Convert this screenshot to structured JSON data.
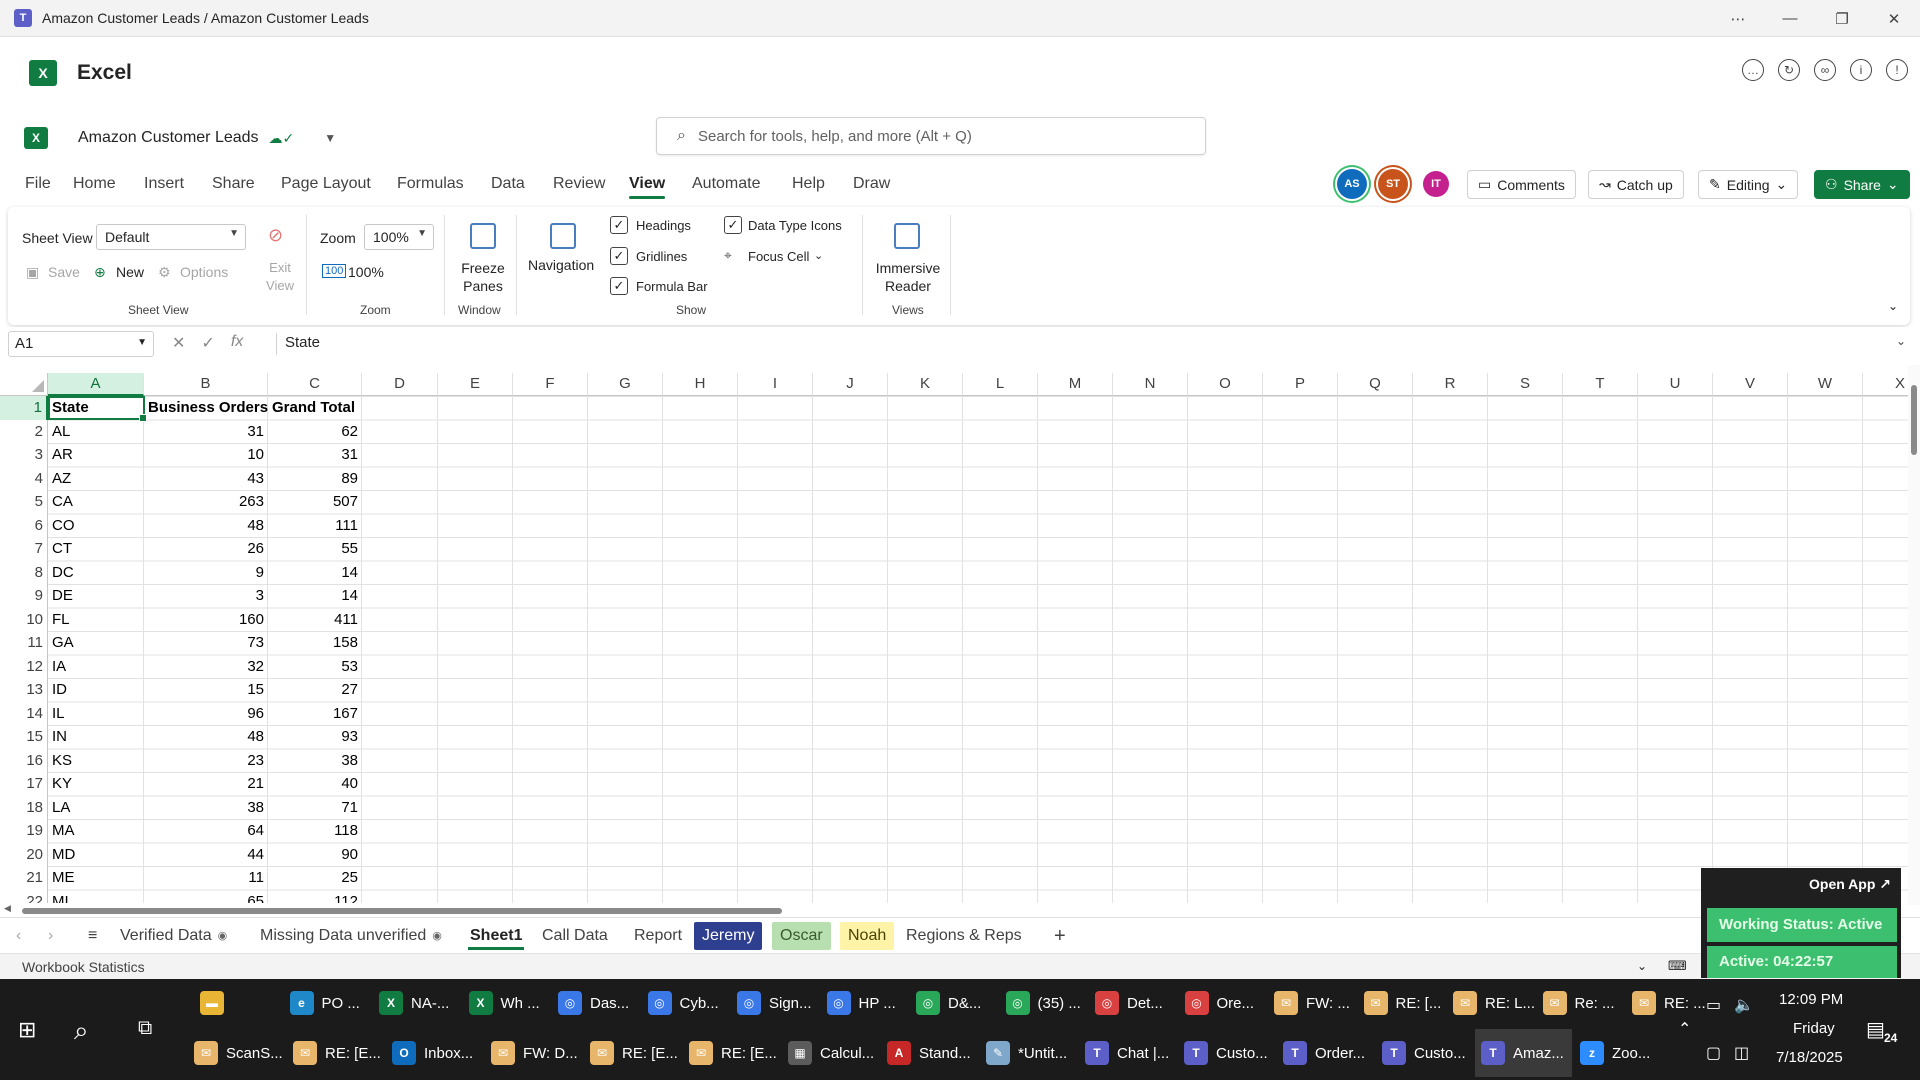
{
  "window": {
    "title": "Amazon Customer Leads / Amazon Customer Leads"
  },
  "app": {
    "name": "Excel"
  },
  "workbook": {
    "name": "Amazon Customer Leads"
  },
  "search": {
    "placeholder": "Search for tools, help, and more (Alt + Q)"
  },
  "menu": [
    "File",
    "Home",
    "Insert",
    "Share",
    "Page Layout",
    "Formulas",
    "Data",
    "Review",
    "View",
    "Automate",
    "Help",
    "Draw"
  ],
  "active_menu": "View",
  "avatars": [
    {
      "initials": "AS",
      "color": "#0f6cbd"
    },
    {
      "initials": "ST",
      "color": "#c8531b"
    },
    {
      "initials": "IT",
      "color": "#c4218f"
    }
  ],
  "top_buttons": {
    "comments": "Comments",
    "catchup": "Catch up",
    "editing": "Editing",
    "share": "Share"
  },
  "ribbon": {
    "sheet_view_label": "Sheet View",
    "sheet_view_value": "Default",
    "save": "Save",
    "new": "New",
    "options": "Options",
    "exit_view": "Exit View",
    "group_sheet_view": "Sheet View",
    "zoom_label": "Zoom",
    "zoom_value": "100%",
    "zoom_100": "100%",
    "group_zoom": "Zoom",
    "freeze_panes": "Freeze Panes",
    "group_window": "Window",
    "navigation": "Navigation",
    "headings": "Headings",
    "gridlines": "Gridlines",
    "formula_bar": "Formula Bar",
    "data_type_icons": "Data Type Icons",
    "focus_cell": "Focus Cell",
    "group_show": "Show",
    "immersive_reader": "Immersive Reader",
    "group_views": "Views"
  },
  "formula_bar": {
    "name_box": "A1",
    "fx": "fx",
    "value": "State"
  },
  "columns": [
    "A",
    "B",
    "C",
    "D",
    "E",
    "F",
    "G",
    "H",
    "I",
    "J",
    "K",
    "L",
    "M",
    "N",
    "O",
    "P",
    "Q",
    "R",
    "S",
    "T",
    "U",
    "V",
    "W",
    "X"
  ],
  "headers": [
    "State",
    "Business Orders",
    "Grand Total"
  ],
  "rows": [
    [
      "AL",
      "31",
      "62"
    ],
    [
      "AR",
      "10",
      "31"
    ],
    [
      "AZ",
      "43",
      "89"
    ],
    [
      "CA",
      "263",
      "507"
    ],
    [
      "CO",
      "48",
      "111"
    ],
    [
      "CT",
      "26",
      "55"
    ],
    [
      "DC",
      "9",
      "14"
    ],
    [
      "DE",
      "3",
      "14"
    ],
    [
      "FL",
      "160",
      "411"
    ],
    [
      "GA",
      "73",
      "158"
    ],
    [
      "IA",
      "32",
      "53"
    ],
    [
      "ID",
      "15",
      "27"
    ],
    [
      "IL",
      "96",
      "167"
    ],
    [
      "IN",
      "48",
      "93"
    ],
    [
      "KS",
      "23",
      "38"
    ],
    [
      "KY",
      "21",
      "40"
    ],
    [
      "LA",
      "38",
      "71"
    ],
    [
      "MA",
      "64",
      "118"
    ],
    [
      "MD",
      "44",
      "90"
    ],
    [
      "ME",
      "11",
      "25"
    ],
    [
      "MI",
      "65",
      "112"
    ]
  ],
  "sheet_tabs": [
    {
      "name": "Verified Data",
      "style": "plain",
      "icon": "eye-icon"
    },
    {
      "name": "Missing Data unverified",
      "style": "plain",
      "icon": "eye-icon"
    },
    {
      "name": "Sheet1",
      "style": "active"
    },
    {
      "name": "Call Data",
      "style": "plain"
    },
    {
      "name": "Report",
      "style": "plain"
    },
    {
      "name": "Jeremy",
      "style": "colored",
      "bg": "#2f3f8f",
      "fg": "#ffffff"
    },
    {
      "name": "Oscar",
      "style": "colored",
      "bg": "#b7dfb0",
      "fg": "#3a5a2a"
    },
    {
      "name": "Noah",
      "style": "colored",
      "bg": "#fff3a8",
      "fg": "#4a4200"
    },
    {
      "name": "Regions & Reps",
      "style": "plain"
    }
  ],
  "status": {
    "text": "Workbook Statistics"
  },
  "widget": {
    "open": "Open App ↗",
    "working": "Working Status: Active",
    "active": "Active: 04:22:57"
  },
  "taskbar": {
    "row1": [
      {
        "label": "",
        "icon": "folder-icon",
        "color": "#e8b534"
      },
      {
        "label": "PO ...",
        "icon": "edge-icon",
        "color": "#1e88c9"
      },
      {
        "label": "NA-...",
        "icon": "excel-icon",
        "color": "#107c41"
      },
      {
        "label": "Wh ...",
        "icon": "excel-icon",
        "color": "#107c41"
      },
      {
        "label": "Das...",
        "icon": "chrome-icon",
        "color": "#3b78e7"
      },
      {
        "label": "Cyb...",
        "icon": "chrome-icon",
        "color": "#3b78e7"
      },
      {
        "label": "Sign...",
        "icon": "chrome-icon",
        "color": "#3b78e7"
      },
      {
        "label": "HP ...",
        "icon": "chrome-icon",
        "color": "#3b78e7"
      },
      {
        "label": "D&...",
        "icon": "chrome-icon",
        "color": "#2aa85a"
      },
      {
        "label": "(35) ...",
        "icon": "chrome-icon",
        "color": "#2aa85a"
      },
      {
        "label": "Det...",
        "icon": "chrome-icon",
        "color": "#d94040"
      },
      {
        "label": "Ore...",
        "icon": "chrome-icon",
        "color": "#d94040"
      },
      {
        "label": "FW: ...",
        "icon": "mail-icon",
        "color": "#e8b66a"
      },
      {
        "label": "RE: [...",
        "icon": "mail-icon",
        "color": "#e8b66a"
      },
      {
        "label": "RE: L...",
        "icon": "mail-icon",
        "color": "#e8b66a"
      },
      {
        "label": "Re: ...",
        "icon": "mail-icon",
        "color": "#e8b66a"
      },
      {
        "label": "RE: ...",
        "icon": "mail-icon",
        "color": "#e8b66a"
      }
    ],
    "row2": [
      {
        "label": "ScanS...",
        "icon": "mail-icon",
        "color": "#e8b66a"
      },
      {
        "label": "RE: [E...",
        "icon": "mail-icon",
        "color": "#e8b66a"
      },
      {
        "label": "Inbox...",
        "icon": "outlook-icon",
        "color": "#0f6cbd"
      },
      {
        "label": "FW: D...",
        "icon": "mail-icon",
        "color": "#e8b66a"
      },
      {
        "label": "RE: [E...",
        "icon": "mail-icon",
        "color": "#e8b66a"
      },
      {
        "label": "RE: [E...",
        "icon": "mail-icon",
        "color": "#e8b66a"
      },
      {
        "label": "Calcul...",
        "icon": "calculator-icon",
        "color": "#5c5c5c"
      },
      {
        "label": "Stand...",
        "icon": "pdf-icon",
        "color": "#c62828"
      },
      {
        "label": "*Untit...",
        "icon": "notepad-icon",
        "color": "#7fa7c9"
      },
      {
        "label": "Chat |...",
        "icon": "teams-icon",
        "color": "#5b5fc7"
      },
      {
        "label": "Custo...",
        "icon": "teams-icon",
        "color": "#5b5fc7"
      },
      {
        "label": "Order...",
        "icon": "teams-icon",
        "color": "#5b5fc7"
      },
      {
        "label": "Custo...",
        "icon": "teams-icon",
        "color": "#5b5fc7"
      },
      {
        "label": "Amaz...",
        "icon": "teams-icon",
        "color": "#5b5fc7",
        "active": true
      },
      {
        "label": "Zoo...",
        "icon": "zoom-icon",
        "color": "#2d8cff"
      }
    ],
    "time": "12:09 PM",
    "day": "Friday",
    "date": "7/18/2025",
    "notifications": "24"
  }
}
